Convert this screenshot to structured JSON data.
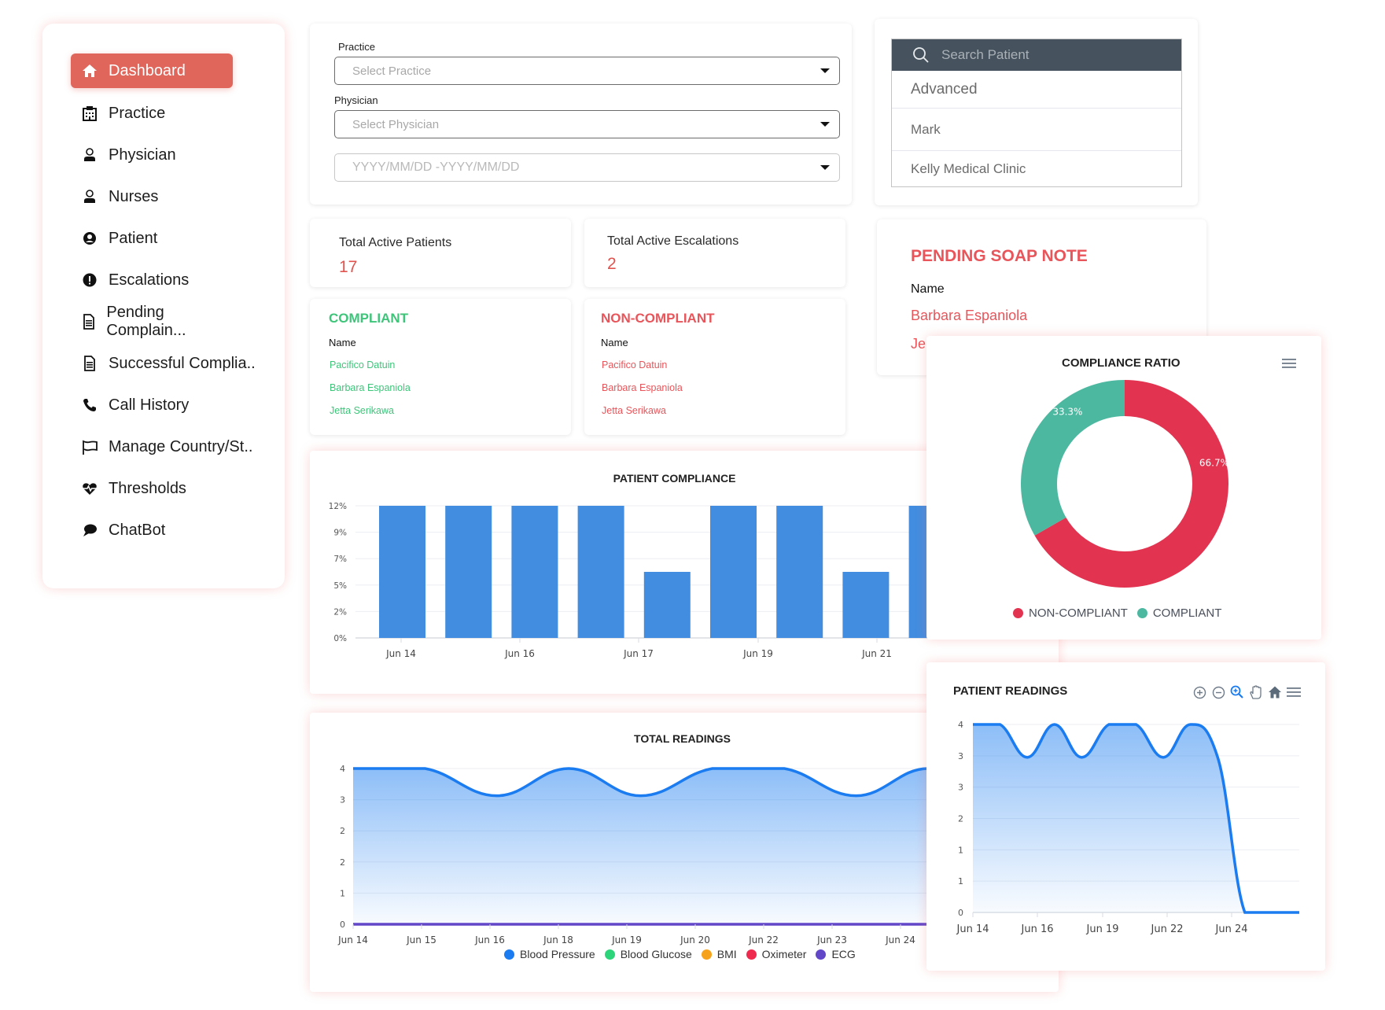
{
  "sidebar": {
    "items": [
      {
        "label": "Dashboard",
        "icon": "home-icon",
        "active": true
      },
      {
        "label": "Practice",
        "icon": "hospital-icon"
      },
      {
        "label": "Physician",
        "icon": "physician-icon"
      },
      {
        "label": "Nurses",
        "icon": "nurse-icon"
      },
      {
        "label": "Patient",
        "icon": "patient-icon"
      },
      {
        "label": "Escalations",
        "icon": "alert-icon"
      },
      {
        "label": "Pending Complain...",
        "icon": "document-icon"
      },
      {
        "label": "Successful Complia..",
        "icon": "document-icon"
      },
      {
        "label": "Call History",
        "icon": "phone-icon"
      },
      {
        "label": "Manage Country/St..",
        "icon": "flag-icon"
      },
      {
        "label": "Thresholds",
        "icon": "heartbeat-icon"
      },
      {
        "label": "ChatBot",
        "icon": "chat-icon"
      }
    ]
  },
  "filters": {
    "practice_label": "Practice",
    "practice_placeholder": "Select Practice",
    "physician_label": "Physician",
    "physician_placeholder": "Select Physician",
    "date_placeholder": "YYYY/MM/DD -YYYY/MM/DD"
  },
  "search": {
    "placeholder": "Search Patient",
    "results": [
      "Advanced",
      "Mark",
      "Kelly Medical Clinic"
    ]
  },
  "stats": {
    "active_patients_label": "Total Active Patients",
    "active_patients_value": "17",
    "active_escalations_label": "Total Active Escalations",
    "active_escalations_value": "2"
  },
  "compliant": {
    "title": "COMPLIANT",
    "column": "Name",
    "names": [
      "Pacifico Datuin",
      "Barbara Espaniola",
      "Jetta Serikawa"
    ]
  },
  "non_compliant": {
    "title": "NON-COMPLIANT",
    "column": "Name",
    "names": [
      "Pacifico Datuin",
      "Barbara Espaniola",
      "Jetta Serikawa"
    ]
  },
  "soap": {
    "title": "PENDING SOAP NOTE",
    "column": "Name",
    "names": [
      "Barbara Espaniola",
      "Je"
    ]
  },
  "colors": {
    "accent": "#e0655a",
    "compliant_green": "#3ec57a",
    "noncompliant_red": "#e8555a",
    "bar_blue": "#428de0",
    "donut_red": "#e23350",
    "donut_teal": "#4db8a0",
    "line_blue": "#1a7cf0"
  },
  "chart_data": [
    {
      "id": "patient_compliance",
      "type": "bar",
      "title": "PATIENT COMPLIANCE",
      "ytick_labels": [
        "0%",
        "2%",
        "5%",
        "7%",
        "9%",
        "12%"
      ],
      "ylim": [
        0,
        12
      ],
      "xtick_labels": [
        "Jun 14",
        "Jun 16",
        "Jun 17",
        "Jun 19",
        "Jun 21"
      ],
      "values": [
        12,
        12,
        12,
        12,
        6,
        12,
        12,
        6,
        12
      ],
      "grid": true
    },
    {
      "id": "compliance_ratio",
      "type": "pie",
      "title": "COMPLIANCE RATIO",
      "slices": [
        {
          "label": "NON-COMPLIANT",
          "value": 66.7,
          "display": "66.7%"
        },
        {
          "label": "COMPLIANT",
          "value": 33.3,
          "display": "33.3%"
        }
      ],
      "legend": "bottom"
    },
    {
      "id": "total_readings",
      "type": "area",
      "title": "TOTAL READINGS",
      "ytick_labels": [
        "0",
        "1",
        "2",
        "2",
        "3",
        "4"
      ],
      "ylim": [
        0,
        4
      ],
      "xtick_labels": [
        "Jun 14",
        "Jun 15",
        "Jun 16",
        "Jun 18",
        "Jun 19",
        "Jun 20",
        "Jun 22",
        "Jun 23",
        "Jun 24"
      ],
      "series": [
        {
          "name": "Blood Pressure",
          "color": "#1a7cf0",
          "values": [
            4,
            4,
            3.3,
            4,
            3.3,
            4,
            4,
            3.3,
            4,
            3.3,
            0,
            0
          ]
        },
        {
          "name": "Blood Glucose",
          "color": "#2ed47a",
          "values": [
            0,
            0,
            0,
            0,
            0,
            0,
            0,
            0,
            0,
            0,
            0,
            0
          ]
        },
        {
          "name": "BMI",
          "color": "#f7a21b",
          "values": [
            0,
            0,
            0,
            0,
            0,
            0,
            0,
            0,
            0,
            0,
            0,
            0
          ]
        },
        {
          "name": "Oximeter",
          "color": "#ee2b4f",
          "values": [
            0,
            0,
            0,
            0,
            0,
            0,
            0,
            0,
            0,
            0,
            0,
            0
          ]
        },
        {
          "name": "ECG",
          "color": "#6247c9",
          "values": [
            0,
            0,
            0,
            0,
            0,
            0,
            0,
            0,
            0,
            0,
            0,
            0
          ]
        }
      ],
      "legend": "bottom"
    },
    {
      "id": "patient_readings",
      "type": "area",
      "title": "PATIENT READINGS",
      "ytick_labels": [
        "0",
        "1",
        "1",
        "2",
        "3",
        "3",
        "4"
      ],
      "ylim": [
        0,
        4
      ],
      "xtick_labels": [
        "Jun 14",
        "Jun 16",
        "Jun 19",
        "Jun 22",
        "Jun 24"
      ],
      "series": [
        {
          "name": "Blood Pressure",
          "color": "#1a7cf0",
          "values": [
            4,
            4,
            3.3,
            4,
            3.3,
            4,
            4,
            3.3,
            4,
            3.3,
            0,
            0,
            0
          ]
        }
      ],
      "toolbar": [
        "zoom-in-icon",
        "zoom-out-icon",
        "selection-zoom-icon",
        "pan-icon",
        "reset-home-icon",
        "menu-icon"
      ]
    }
  ]
}
